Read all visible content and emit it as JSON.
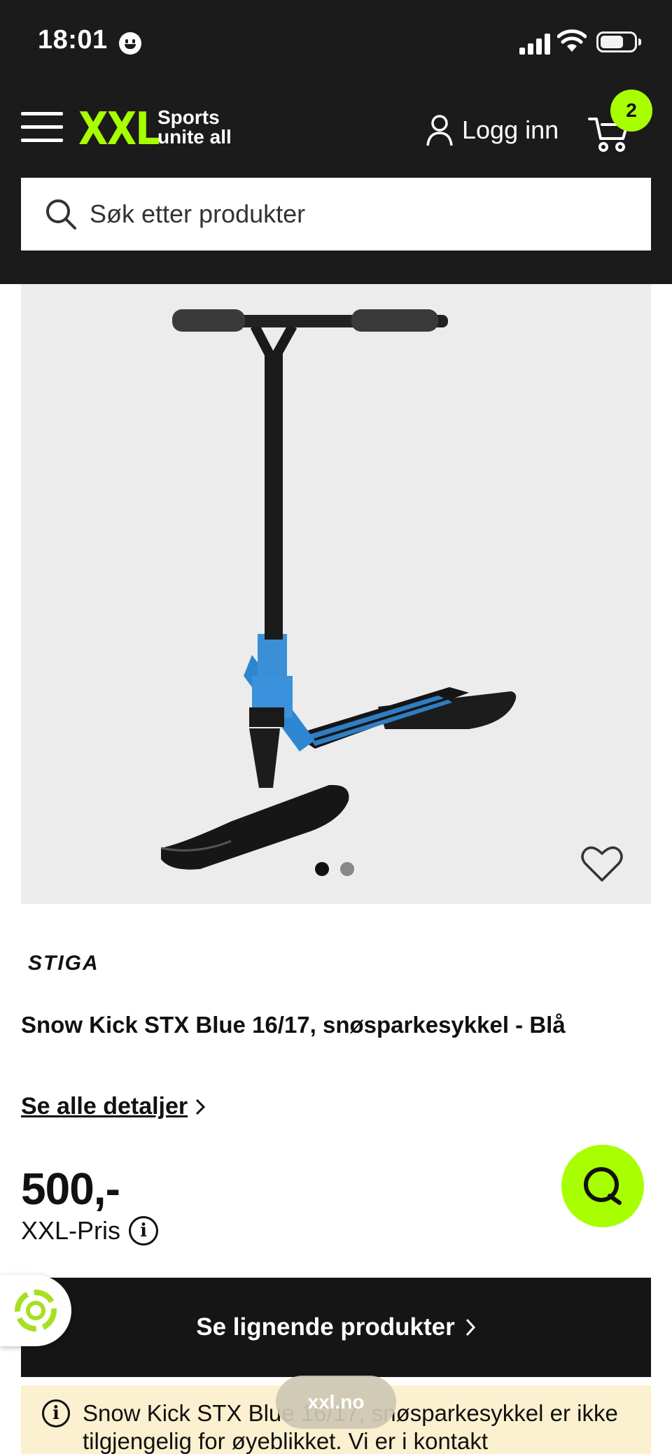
{
  "status_bar": {
    "time": "18:01"
  },
  "header": {
    "logo": "XXL",
    "tagline_line1": "Sports",
    "tagline_line2": "unite all",
    "login_label": "Logg inn",
    "cart_count": "2"
  },
  "search": {
    "placeholder": "Søk etter produkter"
  },
  "gallery": {
    "total_images": 2,
    "active_index": 0,
    "favorite_icon": "heart-outline-icon"
  },
  "product": {
    "brand": "STIGA",
    "title": "Snow Kick STX Blue 16/17, snøsparkesykkel - Blå",
    "details_link": "Se alle detaljer",
    "price": "500,-",
    "price_label": "XXL-Pris"
  },
  "cta": {
    "label": "Se lignende produkter"
  },
  "notice": {
    "text": "Snow Kick STX Blue 16/17, snøsparkesykkel er ikke tilgjengelig for øyeblikket. Vi er i kontakt"
  },
  "browser": {
    "url": "xxl.no"
  },
  "colors": {
    "accent": "#a7ff00",
    "header_bg": "#1b1b1b",
    "notice_bg": "#fbf0cf"
  }
}
